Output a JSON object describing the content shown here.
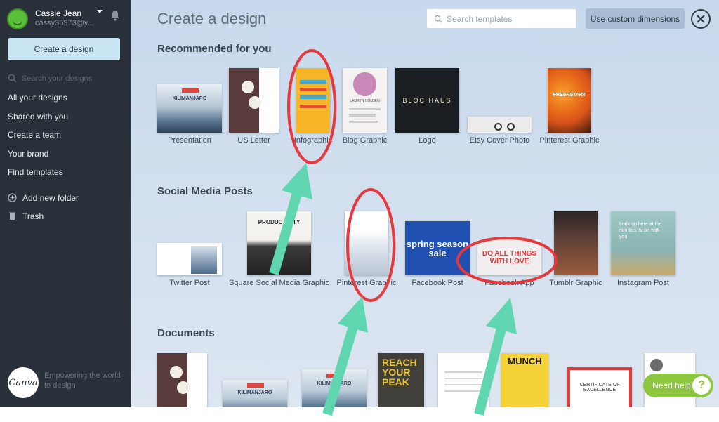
{
  "user": {
    "name": "Cassie Jean",
    "email": "cassy36973@y..."
  },
  "sidebar": {
    "create_button": "Create a design",
    "search_placeholder": "Search your designs",
    "items": [
      {
        "label": "All your designs"
      },
      {
        "label": "Shared with you"
      },
      {
        "label": "Create a team"
      },
      {
        "label": "Your brand"
      },
      {
        "label": "Find templates"
      },
      {
        "label": "Add new folder",
        "icon": "plus-circle-icon"
      },
      {
        "label": "Trash",
        "icon": "trash-icon"
      }
    ],
    "logo_text": "Canva",
    "tagline": "Empowering the world to design"
  },
  "header": {
    "title": "Create a design",
    "search_placeholder": "Search templates",
    "custom_dimensions": "Use custom dimensions"
  },
  "sections": {
    "recommended": {
      "title": "Recommended for you",
      "items": [
        {
          "label": "Presentation",
          "thumb_text": "KILIMANJARO"
        },
        {
          "label": "US Letter"
        },
        {
          "label": "Infographic"
        },
        {
          "label": "Blog Graphic",
          "thumb_text": "LAURYN HOLDEN"
        },
        {
          "label": "Logo",
          "thumb_text": "BLOC HAUS"
        },
        {
          "label": "Etsy Cover Photo"
        },
        {
          "label": "Pinterest Graphic",
          "thumb_text": "FRESHSTART"
        }
      ]
    },
    "social": {
      "title": "Social Media Posts",
      "items": [
        {
          "label": "Twitter Post"
        },
        {
          "label": "Square Social Media Graphic",
          "thumb_text": "PRODUCTIVITY"
        },
        {
          "label": "Pinterest Graphic"
        },
        {
          "label": "Facebook Post",
          "thumb_text": "spring season sale"
        },
        {
          "label": "Facebook App",
          "thumb_text": "DO ALL THINGS WITH LOVE"
        },
        {
          "label": "Tumblr Graphic"
        },
        {
          "label": "Instagram Post",
          "thumb_text": "Look up here at the sun lies, to be with you"
        }
      ]
    },
    "documents": {
      "title": "Documents",
      "items": [
        {
          "label": ""
        },
        {
          "label": "",
          "thumb_text": "KILIMANJARO"
        },
        {
          "label": "",
          "thumb_text": "KILIMANJARO"
        },
        {
          "label": "",
          "thumb_text": "REACH YOUR PEAK"
        },
        {
          "label": ""
        },
        {
          "label": "",
          "thumb_text": "MUNCH"
        },
        {
          "label": "",
          "thumb_text": "CERTIFICATE OF EXCELLENCE"
        },
        {
          "label": ""
        }
      ]
    }
  },
  "help": {
    "label": "Need help",
    "icon_text": "?"
  },
  "annotation_colors": {
    "circle": "#e8373d",
    "arrow": "#5fd6b0"
  }
}
